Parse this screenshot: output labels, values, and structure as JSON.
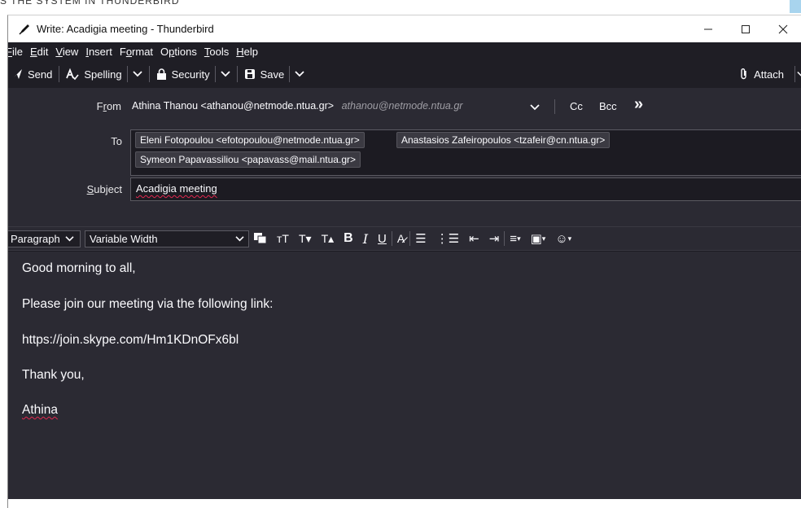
{
  "caption": "S THE SYSTEM IN THUNDERBIRD",
  "window": {
    "title": "Write: Acadigia meeting - Thunderbird",
    "controls": {
      "minimize": "—",
      "maximize": "☐",
      "close": "✕"
    }
  },
  "menu": [
    {
      "label": "File",
      "underline": "F",
      "rest": "ile"
    },
    {
      "label": "Edit",
      "underline": "E",
      "rest": "dit"
    },
    {
      "label": "View",
      "underline": "V",
      "rest": "iew"
    },
    {
      "label": "Insert",
      "underline": "I",
      "rest": "nsert"
    },
    {
      "label": "Format",
      "pre": "F",
      "underline": "o",
      "rest": "rmat"
    },
    {
      "label": "Options",
      "pre": "O",
      "underline": "p",
      "rest": "tions"
    },
    {
      "label": "Tools",
      "underline": "T",
      "rest": "ools"
    },
    {
      "label": "Help",
      "underline": "H",
      "rest": "elp"
    }
  ],
  "toolbar": {
    "send": "Send",
    "spelling": "Spelling",
    "security": "Security",
    "save": "Save",
    "attach": "Attach"
  },
  "headers": {
    "from_label": "From",
    "from_value": "Athina Thanou <athanou@netmode.ntua.gr>",
    "from_identity": "athanou@netmode.ntua.gr",
    "cc": "Cc",
    "bcc": "Bcc",
    "more": "»",
    "to_label": "To",
    "recipients": [
      "Eleni Fotopoulou <efotopoulou@netmode.ntua.gr>",
      "Anastasios Zafeiropoulos <tzafeir@cn.ntua.gr>",
      "Symeon Papavassiliou <papavass@mail.ntua.gr>"
    ],
    "subject_label": "Subject",
    "subject_value": "Acadigia meeting"
  },
  "format": {
    "paragraph": "Paragraph",
    "font": "Variable Width"
  },
  "body": {
    "lines": [
      "Good morning to all,",
      "Please join our meeting via the following link:",
      "https://join.skype.com/Hm1KDnOFx6bl",
      "Thank you,",
      "Athina"
    ]
  },
  "colors": {
    "window_bg": "#1c1b22",
    "header_bg": "#2b2a33",
    "text": "#fbfbfe",
    "spell_error": "#e22850"
  }
}
